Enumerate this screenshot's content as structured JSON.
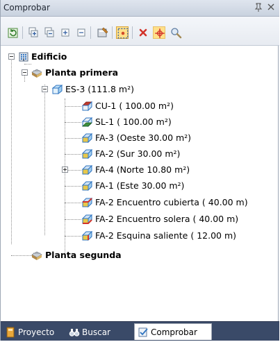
{
  "panel": {
    "title": "Comprobar",
    "pin_glyph": "ᵖ",
    "close_glyph": "x"
  },
  "toolbar": {
    "buttons": [
      "refresh-icon",
      "expand-all-icon",
      "collapse-all-icon",
      "expand-level-icon",
      "collapse-level-icon",
      "properties-icon",
      "select-region-icon",
      "delete-icon",
      "center-icon",
      "zoom-icon"
    ]
  },
  "tree": {
    "root": {
      "label": "Edificio"
    },
    "floor1": {
      "label": "Planta primera"
    },
    "space": {
      "label": "ES-3 (111.8 m²)"
    },
    "items": [
      {
        "label": "CU-1  ( 100.00 m²)",
        "icon": "roof-icon"
      },
      {
        "label": "SL-1  ( 100.00 m²)",
        "icon": "slab-icon"
      },
      {
        "label": "FA-3  (Oeste 30.00 m²)",
        "icon": "facade-icon"
      },
      {
        "label": "FA-2  (Sur 30.00 m²)",
        "icon": "facade-icon"
      },
      {
        "label": "FA-4  (Norte 10.80 m²)",
        "icon": "facade-icon"
      },
      {
        "label": "FA-1  (Este 30.00 m²)",
        "icon": "facade-icon"
      },
      {
        "label": "FA-2 Encuentro cubierta ( 40.00 m)",
        "icon": "junction-roof-icon"
      },
      {
        "label": "FA-2 Encuentro solera ( 40.00 m)",
        "icon": "junction-slab-icon"
      },
      {
        "label": "FA-2 Esquina saliente ( 12.00 m)",
        "icon": "corner-icon"
      }
    ],
    "floor2": {
      "label": "Planta segunda"
    }
  },
  "tabs": [
    {
      "label": "Proyecto",
      "icon": "project-book-icon",
      "active": false
    },
    {
      "label": "Buscar",
      "icon": "binoculars-icon",
      "active": false
    },
    {
      "label": "Comprobar",
      "icon": "check-icon",
      "active": true
    }
  ],
  "colors": {
    "accent": "#3a4a68",
    "selected": "#ffe08a",
    "facade": "#e8c84a",
    "roof_red": "#c0392b",
    "slab_green": "#3e8f3e",
    "cube_blue": "#2f74c0"
  }
}
